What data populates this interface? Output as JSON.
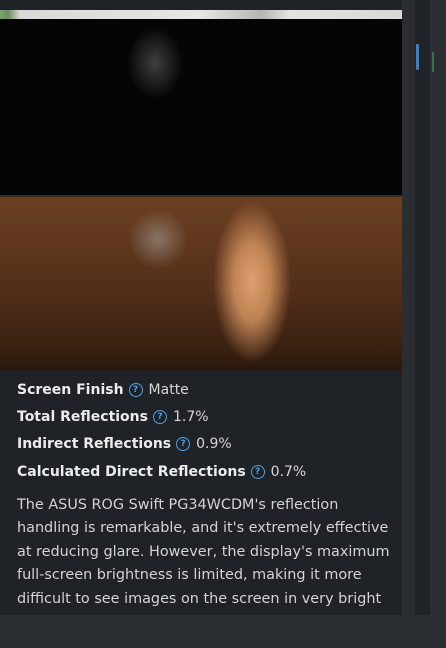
{
  "specs": [
    {
      "label": "Screen Finish",
      "value": "Matte"
    },
    {
      "label": "Total Reflections",
      "value": "1.7%"
    },
    {
      "label": "Indirect Reflections",
      "value": "0.9%"
    },
    {
      "label": "Calculated Direct Reflections",
      "value": "0.7%"
    }
  ],
  "help_icon_glyph": "?",
  "description": "The ASUS ROG Swift PG34WCDM's reflection handling is remarkable, and it's extremely effective at reducing glare. However, the display's maximum full-screen brightness is limited, making it more difficult to see images on the screen in very bright environments.",
  "colors": {
    "accent": "#4aa3e8",
    "background": "#1f2226"
  }
}
